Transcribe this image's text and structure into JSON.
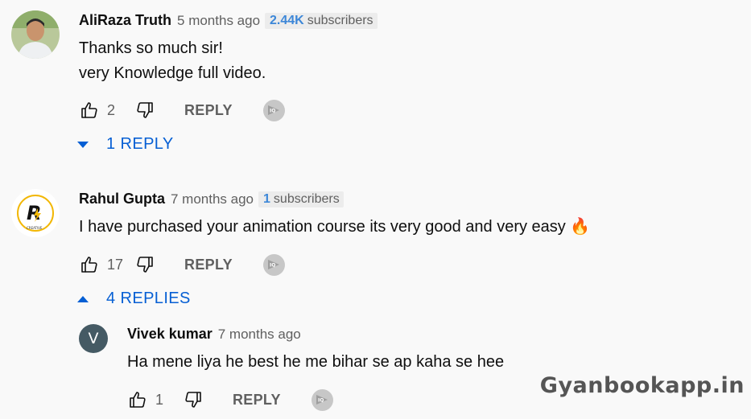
{
  "comments": [
    {
      "author": "AliRaza Truth",
      "time": "5 months ago",
      "subs_count": "2.44K",
      "subs_label": "subscribers",
      "lines": [
        "Thanks so much sir!",
        "very Knowledge full video."
      ],
      "likes": "2",
      "reply_label": "REPLY",
      "replies_toggle": "1 REPLY"
    },
    {
      "author": "Rahul Gupta",
      "time": "7 months ago",
      "subs_count": "1",
      "subs_label": "subscribers",
      "text": "I have purchased your animation course its very good and very easy 🔥",
      "likes": "17",
      "reply_label": "REPLY",
      "replies_toggle": "4 REPLIES"
    }
  ],
  "reply": {
    "avatar_letter": "V",
    "author": "Vivek kumar",
    "time": "7 months ago",
    "text": "Ha mene liya he best he me bihar se ap kaha se hee",
    "likes": "1",
    "reply_label": "REPLY"
  },
  "watermark": "Gyanbookapp.in",
  "colors": {
    "link_blue": "#065fd4",
    "subs_blue": "#3d87d8",
    "muted": "#606060"
  }
}
